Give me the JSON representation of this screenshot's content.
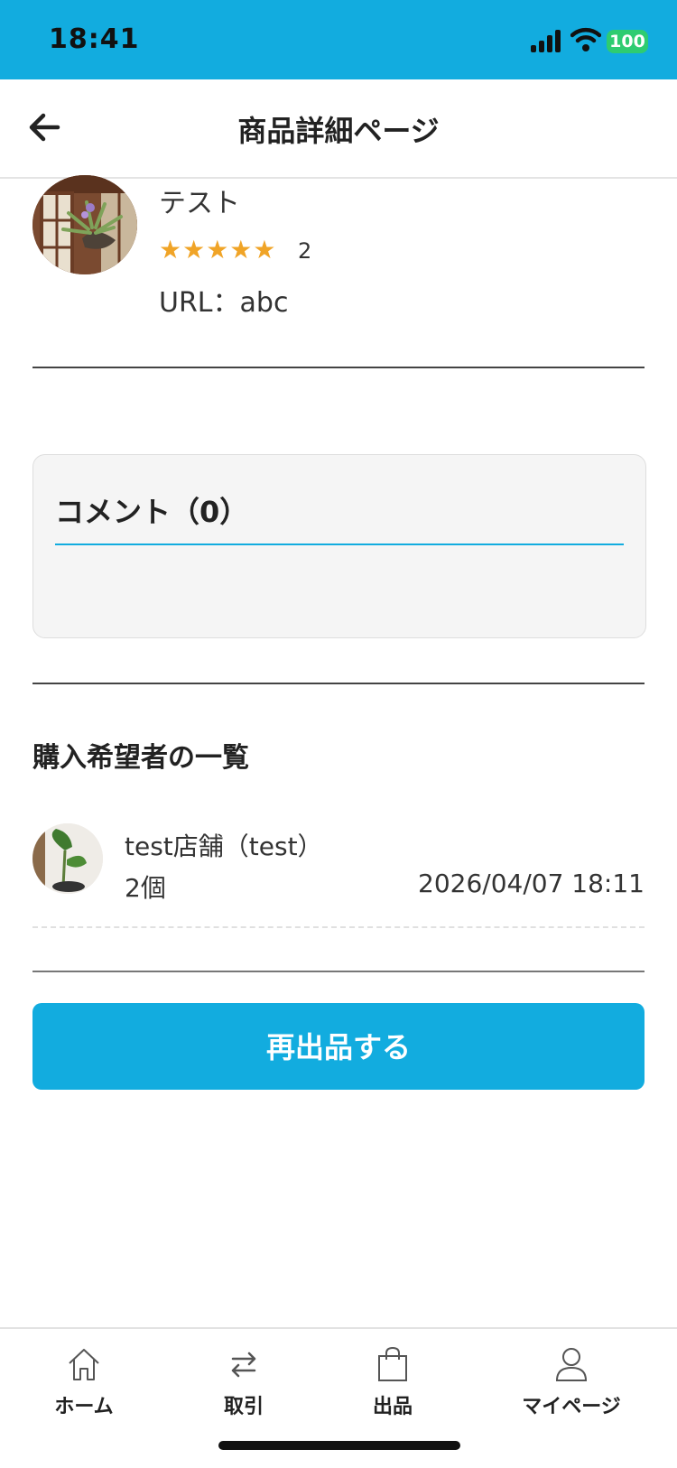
{
  "status_bar": {
    "time": "18:41",
    "battery": "100",
    "icons": [
      "signal-icon",
      "wifi-icon",
      "battery-icon"
    ]
  },
  "header": {
    "title": "商品詳細ページ",
    "back_icon": "arrow-left-icon"
  },
  "seller": {
    "name": "テスト",
    "stars": "★★★★★",
    "rating_count": "2",
    "url_text": "URL：abc",
    "rating_value": 5,
    "rating_max": 5
  },
  "comments": {
    "title": "コメント（0）"
  },
  "buyers": {
    "heading": "購入希望者の一覧",
    "items": [
      {
        "name": "test店舗（test）",
        "quantity": "2個",
        "date": "2026/04/07 18:11"
      }
    ]
  },
  "actions": {
    "relist_label": "再出品する"
  },
  "tab_bar": {
    "tabs": [
      {
        "label": "ホーム",
        "icon": "home-icon"
      },
      {
        "label": "取引",
        "icon": "transfer-icon"
      },
      {
        "label": "出品",
        "icon": "shopping-bag-icon"
      },
      {
        "label": "マイページ",
        "icon": "user-icon"
      }
    ]
  },
  "colors": {
    "accent": "#12ACDF",
    "star": "#F0A427",
    "battery": "#2ECC71"
  }
}
